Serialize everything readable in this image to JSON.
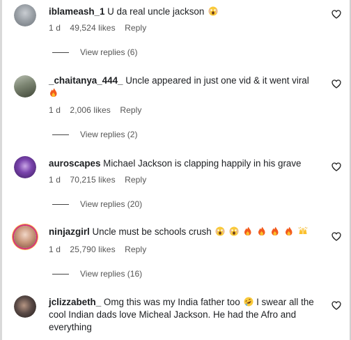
{
  "comments": [
    {
      "username": "iblameash_1",
      "text": "U da real uncle jackson",
      "emojis": [
        "scream-face"
      ],
      "time": "1 d",
      "likes": "49,524 likes",
      "reply_label": "Reply",
      "view_replies": "View replies (6)",
      "avatar_color": "#8a8f96"
    },
    {
      "username": "_chaitanya_444_",
      "text": "Uncle appeared in just one vid & it went viral",
      "emojis": [
        "fire"
      ],
      "time": "1 d",
      "likes": "2,006 likes",
      "reply_label": "Reply",
      "view_replies": "View replies (2)",
      "avatar_color": "#55604f"
    },
    {
      "username": "auroscapes",
      "text": "Michael Jackson is clapping happily in his grave",
      "emojis": [],
      "time": "1 d",
      "likes": "70,215 likes",
      "reply_label": "Reply",
      "view_replies": "View replies (20)",
      "avatar_color": "#5b2f86"
    },
    {
      "username": "ninjazgirl",
      "text": "Uncle must be schools crush",
      "emojis": [
        "scream-face",
        "scream-face",
        "fire",
        "fire",
        "fire",
        "fire",
        "raising-hands"
      ],
      "time": "1 d",
      "likes": "25,790 likes",
      "reply_label": "Reply",
      "view_replies": "View replies (16)",
      "avatar_color": "#c79a80"
    },
    {
      "username": "jclizzabeth_",
      "text": "Omg this was my India father too",
      "text2": "I swear all the cool Indian dads love Micheal Jackson. He had the Afro and everything",
      "emojis": [
        "rofl"
      ],
      "emojis2": [
        "rofl"
      ],
      "avatar_color": "#3b3535"
    }
  ],
  "colors": {
    "text": "#1c1e21",
    "meta": "#555555",
    "story_ring": "#d3317a"
  }
}
